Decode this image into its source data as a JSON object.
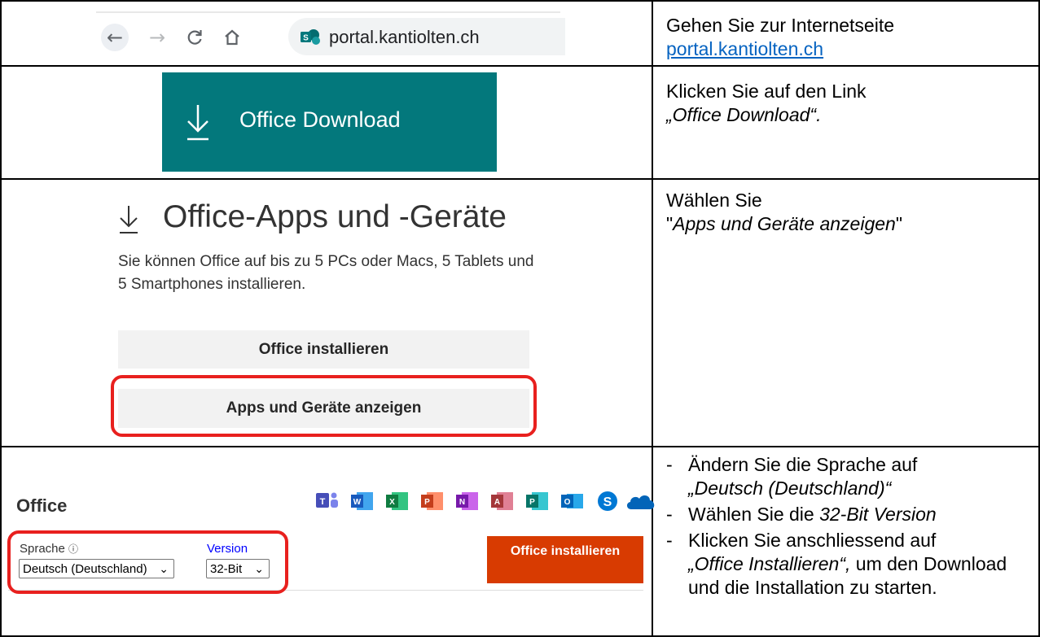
{
  "row1": {
    "url": "portal.kantiolten.ch",
    "instruction_text": "Gehen Sie zur Internetseite",
    "instruction_link": "portal.kantiolten.ch",
    "icons": [
      "back-arrow-icon",
      "forward-arrow-icon",
      "reload-icon",
      "home-icon",
      "sharepoint-icon"
    ]
  },
  "row2": {
    "tile_label": "Office Download",
    "tile_color": "#03787c",
    "instruction_line1": "Klicken Sie auf den Link",
    "instruction_line2": "„Office Download“."
  },
  "row3": {
    "title": "Office-Apps und -Geräte",
    "description": "Sie können Office auf bis zu 5 PCs oder Macs, 5 Tablets und 5 Smartphones installieren.",
    "button_install": "Office installieren",
    "button_apps": "Apps und Geräte anzeigen",
    "instruction_line1": "Wählen Sie",
    "instruction_line2_prefix": "\"",
    "instruction_line2_em": "Apps und Geräte anzeigen",
    "instruction_line2_suffix": "\""
  },
  "row4": {
    "office_label": "Office",
    "app_icons": [
      "teams-icon",
      "word-icon",
      "excel-icon",
      "powerpoint-icon",
      "onenote-icon",
      "access-icon",
      "publisher-icon",
      "outlook-icon",
      "skype-icon",
      "onedrive-icon"
    ],
    "language_label": "Sprache",
    "language_value": "Deutsch (Deutschland)",
    "version_label": "Version",
    "version_value": "32-Bit",
    "install_button": "Office installieren",
    "install_color": "#d83b01",
    "bullet1_text": "Ändern Sie die Sprache auf",
    "bullet1_em": "„Deutsch (Deutschland)“",
    "bullet2_text": "Wählen Sie die",
    "bullet2_em": "32-Bit Version",
    "bullet3_text": "Klicken Sie anschliessend auf",
    "bullet3_em": "„Office Installieren“,",
    "bullet3_rest": "um den Download und die Installation zu starten."
  },
  "highlight_color": "#e8201e"
}
